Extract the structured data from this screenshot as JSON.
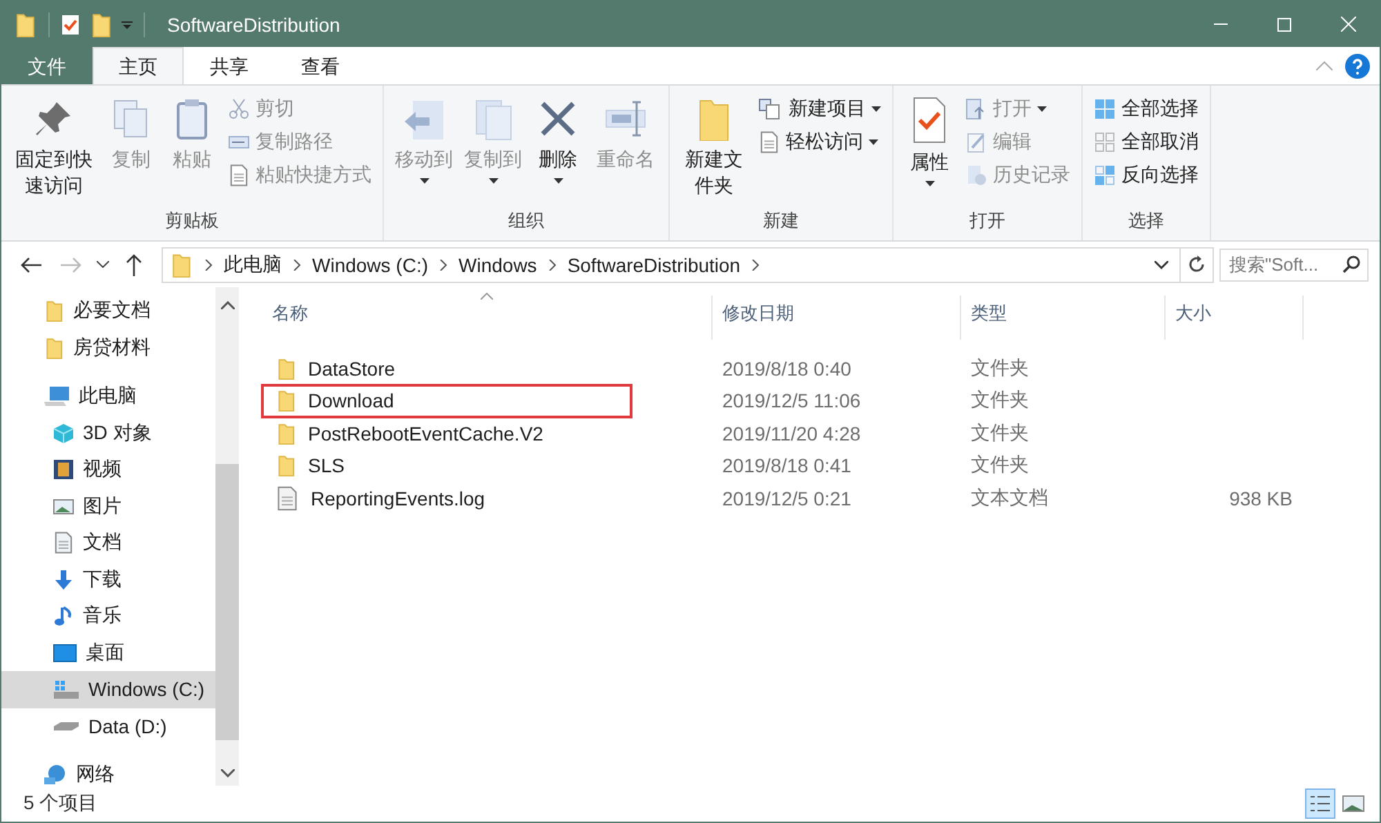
{
  "window": {
    "title": "SoftwareDistribution"
  },
  "ribbon_tabs": [
    {
      "label": "文件",
      "kind": "file",
      "selected": false
    },
    {
      "label": "主页",
      "kind": "tab",
      "selected": true
    },
    {
      "label": "共享",
      "kind": "tab",
      "selected": false
    },
    {
      "label": "查看",
      "kind": "tab",
      "selected": false
    }
  ],
  "ribbon_groups": [
    {
      "label": "剪贴板",
      "items": [
        {
          "kind": "large",
          "label": "固定到快速访问",
          "disabled": false,
          "has_menu": false
        },
        {
          "kind": "large",
          "label": "复制",
          "disabled": true,
          "has_menu": false
        },
        {
          "kind": "large",
          "label": "粘贴",
          "disabled": true,
          "has_menu": false
        },
        {
          "kind": "stack",
          "buttons": [
            {
              "label": "剪切",
              "disabled": true,
              "has_menu": false
            },
            {
              "label": "复制路径",
              "disabled": true,
              "has_menu": false
            },
            {
              "label": "粘贴快捷方式",
              "disabled": true,
              "has_menu": false
            }
          ]
        }
      ]
    },
    {
      "label": "组织",
      "items": [
        {
          "kind": "large",
          "label": "移动到",
          "disabled": true,
          "has_menu": true
        },
        {
          "kind": "large",
          "label": "复制到",
          "disabled": true,
          "has_menu": true
        },
        {
          "kind": "large",
          "label": "删除",
          "disabled": false,
          "has_menu": true
        },
        {
          "kind": "large",
          "label": "重命名",
          "disabled": true,
          "has_menu": false
        }
      ]
    },
    {
      "label": "新建",
      "items": [
        {
          "kind": "large",
          "label": "新建文件夹",
          "disabled": false,
          "has_menu": false
        },
        {
          "kind": "stack",
          "buttons": [
            {
              "label": "新建项目",
              "disabled": false,
              "has_menu": true
            },
            {
              "label": "轻松访问",
              "disabled": false,
              "has_menu": true
            }
          ]
        }
      ]
    },
    {
      "label": "打开",
      "items": [
        {
          "kind": "large",
          "label": "属性",
          "disabled": false,
          "has_menu": true
        },
        {
          "kind": "stack",
          "buttons": [
            {
              "label": "打开",
              "disabled": true,
              "has_menu": true
            },
            {
              "label": "编辑",
              "disabled": true,
              "has_menu": false
            },
            {
              "label": "历史记录",
              "disabled": true,
              "has_menu": false
            }
          ]
        }
      ]
    },
    {
      "label": "选择",
      "items": [
        {
          "kind": "stack",
          "buttons": [
            {
              "label": "全部选择",
              "disabled": false,
              "has_menu": false
            },
            {
              "label": "全部取消",
              "disabled": false,
              "has_menu": false
            },
            {
              "label": "反向选择",
              "disabled": false,
              "has_menu": false
            }
          ]
        }
      ]
    }
  ],
  "address_bar": {
    "path": [
      "此电脑",
      "Windows (C:)",
      "Windows",
      "SoftwareDistribution"
    ]
  },
  "search": {
    "placeholder": "搜索\"Soft..."
  },
  "sidebar": {
    "items": [
      {
        "label": "必要文档",
        "kind": "folder",
        "selected": false
      },
      {
        "label": "房贷材料",
        "kind": "folder",
        "selected": false
      },
      {
        "label": "此电脑",
        "kind": "pc",
        "selected": false,
        "children": [
          {
            "label": "3D 对象",
            "kind": "cube",
            "selected": false
          },
          {
            "label": "视频",
            "kind": "video",
            "selected": false
          },
          {
            "label": "图片",
            "kind": "image",
            "selected": false
          },
          {
            "label": "文档",
            "kind": "doc",
            "selected": false
          },
          {
            "label": "下载",
            "kind": "download",
            "selected": false
          },
          {
            "label": "音乐",
            "kind": "music",
            "selected": false
          },
          {
            "label": "桌面",
            "kind": "desktop",
            "selected": false
          },
          {
            "label": "Windows (C:)",
            "kind": "drive_c",
            "selected": true
          },
          {
            "label": "Data (D:)",
            "kind": "drive",
            "selected": false
          }
        ]
      },
      {
        "label": "网络",
        "kind": "network",
        "selected": false
      }
    ]
  },
  "table": {
    "columns": [
      "名称",
      "修改日期",
      "类型",
      "大小"
    ],
    "rows": [
      {
        "kind": "folder",
        "name": "DataStore",
        "modified": "2019/8/18 0:40",
        "type": "文件夹",
        "annotated": false
      },
      {
        "kind": "folder",
        "name": "Download",
        "modified": "2019/12/5 11:06",
        "type": "文件夹",
        "annotated": true
      },
      {
        "kind": "folder",
        "name": "PostRebootEventCache.V2",
        "modified": "2019/11/20 4:28",
        "type": "文件夹",
        "annotated": false
      },
      {
        "kind": "folder",
        "name": "SLS",
        "modified": "2019/8/18 0:41",
        "type": "文件夹",
        "annotated": false
      },
      {
        "kind": "file",
        "name": "ReportingEvents.log",
        "modified": "2019/12/5 0:21",
        "type": "文本文档",
        "size": "938 KB",
        "annotated": false
      }
    ]
  },
  "status_bar": {
    "count": "5 个项目"
  },
  "view_buttons": [
    {
      "kind": "details",
      "selected": true
    },
    {
      "kind": "thumbnails",
      "selected": false
    }
  ]
}
